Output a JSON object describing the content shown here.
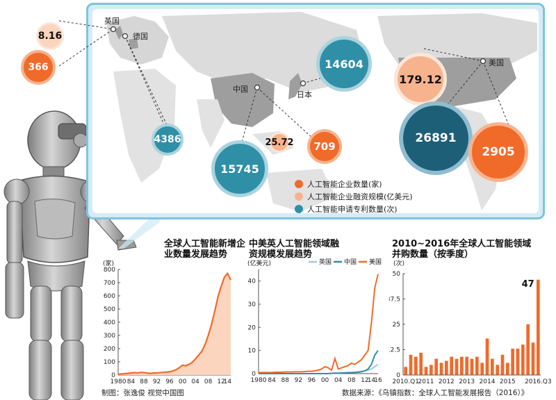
{
  "colors": {
    "orange": "#f06a2a",
    "light_orange": "#f7b38d",
    "teal": "#2f8fa6",
    "dark_teal": "#1e5f78",
    "gray_land": "#9e9e9e",
    "fill_orange": "#fbd5bd"
  },
  "map": {
    "countries": {
      "uk": "英国",
      "germany": "德国",
      "china": "中国",
      "japan": "日本",
      "usa": "美国"
    },
    "values": {
      "uk_funding": "8.16",
      "uk_companies": "366",
      "germany_patents": "4386",
      "china_patents": "15745",
      "china_funding": "25.72",
      "china_companies": "709",
      "japan_patents": "14604",
      "usa_funding": "179.12",
      "usa_patents": "26891",
      "usa_companies": "2905"
    },
    "legend": [
      {
        "label": "人工智能企业数量(家)",
        "color": "#f06a2a"
      },
      {
        "label": "人工智能企业融资规模(亿美元)",
        "color": "#f7b38d"
      },
      {
        "label": "人工智能申请专利数量(次)",
        "color": "#2f8fa6"
      }
    ]
  },
  "chart_data": [
    {
      "type": "area",
      "title": "全球人工智能新增企业数量发展趋势",
      "unit": "(家)",
      "ylim": [
        0,
        800
      ],
      "yticks": [
        "0",
        "100",
        "200",
        "300",
        "400",
        "500",
        "600",
        "700",
        "800"
      ],
      "xtick_labels": [
        "1980",
        "84",
        "88",
        "92",
        "96",
        "00",
        "04",
        "08",
        "12",
        "14"
      ],
      "xtick_years": [
        1980,
        1984,
        1988,
        1992,
        1996,
        2000,
        2004,
        2008,
        2012,
        2014
      ],
      "x": [
        1980,
        1981,
        1982,
        1983,
        1984,
        1985,
        1986,
        1987,
        1988,
        1989,
        1990,
        1991,
        1992,
        1993,
        1994,
        1995,
        1996,
        1997,
        1998,
        1999,
        2000,
        2001,
        2002,
        2003,
        2004,
        2005,
        2006,
        2007,
        2008,
        2009,
        2010,
        2011,
        2012,
        2013,
        2014,
        2015
      ],
      "values": [
        5,
        8,
        10,
        12,
        15,
        18,
        15,
        20,
        18,
        15,
        12,
        15,
        15,
        18,
        20,
        22,
        25,
        30,
        40,
        55,
        75,
        70,
        80,
        95,
        120,
        150,
        180,
        230,
        300,
        380,
        480,
        590,
        670,
        740,
        770,
        720
      ]
    },
    {
      "type": "line",
      "title": "中美英人工智能领域融资规模发展趋势",
      "unit": "(亿美元)",
      "ylim": [
        0,
        45
      ],
      "yticks": [
        "0",
        "10",
        "20",
        "30",
        "40"
      ],
      "xtick_labels": [
        "1980",
        "84",
        "88",
        "92",
        "96",
        "00",
        "04",
        "08",
        "12",
        "14",
        "16"
      ],
      "xtick_years": [
        1980,
        1984,
        1988,
        1992,
        1996,
        2000,
        2004,
        2008,
        2012,
        2014,
        2016
      ],
      "x": [
        1980,
        1981,
        1982,
        1983,
        1984,
        1985,
        1986,
        1987,
        1988,
        1989,
        1990,
        1991,
        1992,
        1993,
        1994,
        1995,
        1996,
        1997,
        1998,
        1999,
        2000,
        2001,
        2002,
        2003,
        2004,
        2005,
        2006,
        2007,
        2008,
        2009,
        2010,
        2011,
        2012,
        2013,
        2014,
        2015,
        2016
      ],
      "series": [
        {
          "name": "英国",
          "color": "#9ecbdb",
          "values": [
            0,
            0,
            0,
            0,
            0,
            0,
            0,
            0,
            0,
            0,
            0,
            0,
            0,
            0,
            0,
            0,
            0,
            0,
            0,
            0,
            0,
            0,
            0.2,
            0.3,
            0.2,
            0.3,
            0.4,
            0.5,
            0.5,
            0.6,
            0.8,
            1.0,
            1.2,
            1.5,
            2.0,
            3.0,
            4.0
          ]
        },
        {
          "name": "中国",
          "color": "#2f8fa6",
          "values": [
            0,
            0,
            0,
            0,
            0,
            0,
            0,
            0,
            0,
            0,
            0,
            0,
            0,
            0,
            0,
            0,
            0,
            0,
            0,
            0,
            0,
            0,
            0.1,
            0.2,
            0.2,
            0.3,
            0.3,
            0.4,
            0.4,
            0.5,
            0.6,
            0.8,
            1.2,
            2.0,
            4.0,
            8.0,
            10.0
          ]
        },
        {
          "name": "美国",
          "color": "#f06a2a",
          "values": [
            0.5,
            0.5,
            0.5,
            0.5,
            0.5,
            0.6,
            0.6,
            0.6,
            0.7,
            0.7,
            0.7,
            0.8,
            0.8,
            0.8,
            0.9,
            1.0,
            1.0,
            1.2,
            1.5,
            2.0,
            3.0,
            2.5,
            1.5,
            6.5,
            2.0,
            2.5,
            3.0,
            3.5,
            4.5,
            4.0,
            5.0,
            6.0,
            8.0,
            10.0,
            22.0,
            37.0,
            43.0
          ]
        }
      ]
    },
    {
      "type": "bar",
      "title": "2010~2016年全球人工智能领域并购数量（按季度）",
      "unit": "(次)",
      "ylim": [
        0,
        50
      ],
      "yticks": [
        "0",
        "12.5",
        "25",
        "37.5",
        "50"
      ],
      "xtick_labels": [
        "2010.Q1",
        "2011",
        "2012",
        "2013",
        "2014",
        "2015",
        "2016.Q3"
      ],
      "xtick_index": [
        0,
        4,
        8,
        12,
        16,
        20,
        26
      ],
      "annotation": "47",
      "values": [
        4,
        10,
        9,
        11,
        4,
        5,
        8,
        6,
        7,
        9,
        8,
        9,
        9,
        8,
        9,
        6,
        18,
        8,
        5,
        10,
        6,
        13,
        13,
        15,
        25,
        16,
        47
      ]
    }
  ],
  "footer": {
    "credit": "制图：张逸俊  视觉中国图",
    "source": "数据来源：《乌镇指数：全球人工智能发展报告（2016）》"
  }
}
